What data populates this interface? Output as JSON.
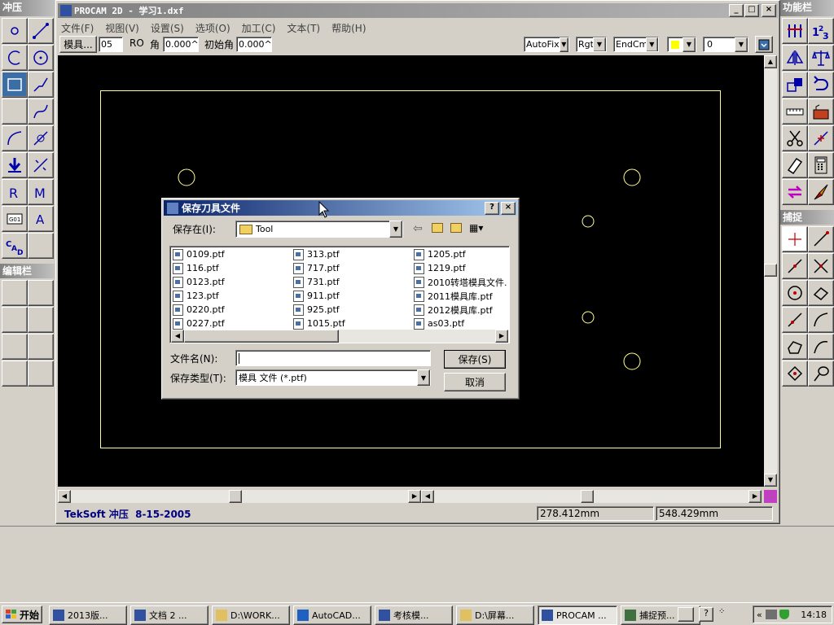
{
  "app": {
    "title": "PROCAM 2D - 学习1.dxf",
    "menu": [
      "文件(F)",
      "视图(V)",
      "设置(S)",
      "选项(O)",
      "加工(C)",
      "文本(T)",
      "帮助(H)"
    ]
  },
  "toolbar": {
    "die_button": "模具...",
    "die_value": "05",
    "ro_label": "RO",
    "angle_label": "角",
    "angle_value": "0.000^",
    "start_angle_label": "初始角",
    "start_angle_value": "0.000^",
    "autofix": "AutoFix",
    "rgt": "Rgt",
    "endcmp": "EndCmp",
    "layer": "0"
  },
  "left_panel": {
    "title": "冲压",
    "edit_title": "编辑栏"
  },
  "right_panel": {
    "title": "功能栏",
    "snap_title": "捕捉"
  },
  "dialog": {
    "title": "保存刀具文件",
    "save_in_label": "保存在(I):",
    "folder": "Tool",
    "files": [
      "0109.ptf",
      "116.ptf",
      "0123.ptf",
      "123.ptf",
      "0220.ptf",
      "0227.ptf",
      "313.ptf",
      "717.ptf",
      "731.ptf",
      "911.ptf",
      "925.ptf",
      "1015.ptf",
      "1205.ptf",
      "1219.ptf",
      "2010转塔模具文件.",
      "2011模具库.ptf",
      "2012模具库.ptf",
      "as03.ptf"
    ],
    "filename_label": "文件名(N):",
    "filename_value": "",
    "filetype_label": "保存类型(T):",
    "filetype_value": "模具 文件 (*.ptf)",
    "save_button": "保存(S)",
    "cancel_button": "取消",
    "help_button": "?",
    "close_button": "×"
  },
  "status": {
    "left": "TekSoft 冲压  8-15-2005",
    "x_coord": "278.412mm",
    "y_coord": "548.429mm"
  },
  "taskbar": {
    "start": "开始",
    "items": [
      "2013版...",
      "文档 2 ...",
      "D:\\WORK...",
      "AutoCAD...",
      "考核模...",
      "D:\\屏幕...",
      "PROCAM ...",
      "捕捉预..."
    ],
    "clock": "14:18"
  },
  "colors": {
    "canvas": "#000000",
    "geometry": "#ffff99",
    "accent": "#0a246a",
    "status_text": "#000080",
    "magenta": "#c040c0"
  }
}
